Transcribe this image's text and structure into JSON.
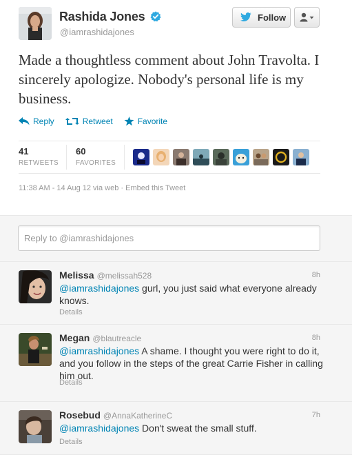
{
  "user": {
    "name": "Rashida Jones",
    "handle": "@iamrashidajones",
    "verified": true
  },
  "buttons": {
    "follow_label": "Follow"
  },
  "tweet": {
    "text": "Made a thoughtless comment about John Travolta. I sincerely apologize. Nobody's personal life is my business.",
    "actions": {
      "reply": "Reply",
      "retweet": "Retweet",
      "favorite": "Favorite"
    },
    "stats": {
      "retweets_count": "41",
      "retweets_label": "RETWEETS",
      "favorites_count": "60",
      "favorites_label": "FAVORITES"
    },
    "favoriter_avatar_count": 10,
    "meta": "11:38 AM - 14 Aug 12 via web · Embed this Tweet"
  },
  "reply_box": {
    "placeholder": "Reply to @iamrashidajones"
  },
  "replies": [
    {
      "name": "Melissa",
      "handle": "@melissah528",
      "time": "8h",
      "mention": "@iamrashidajones",
      "text": " gurl, you just said what everyone already knows.",
      "details": "Details"
    },
    {
      "name": "Megan",
      "handle": "@blautreacle",
      "time": "8h",
      "mention": "@iamrashidajones",
      "text": " A shame. I thought you were right to do it, and you follow in the steps of the great Carrie Fisher in calling him out.",
      "details": "Details"
    },
    {
      "name": "Rosebud",
      "handle": "@AnnaKatherineC",
      "time": "7h",
      "mention": "@iamrashidajones",
      "text": " Don't sweat the small stuff.",
      "details": "Details"
    }
  ],
  "colors": {
    "link": "#0084b4",
    "verified": "#2fa9e0",
    "muted": "#999999",
    "text": "#333333"
  }
}
